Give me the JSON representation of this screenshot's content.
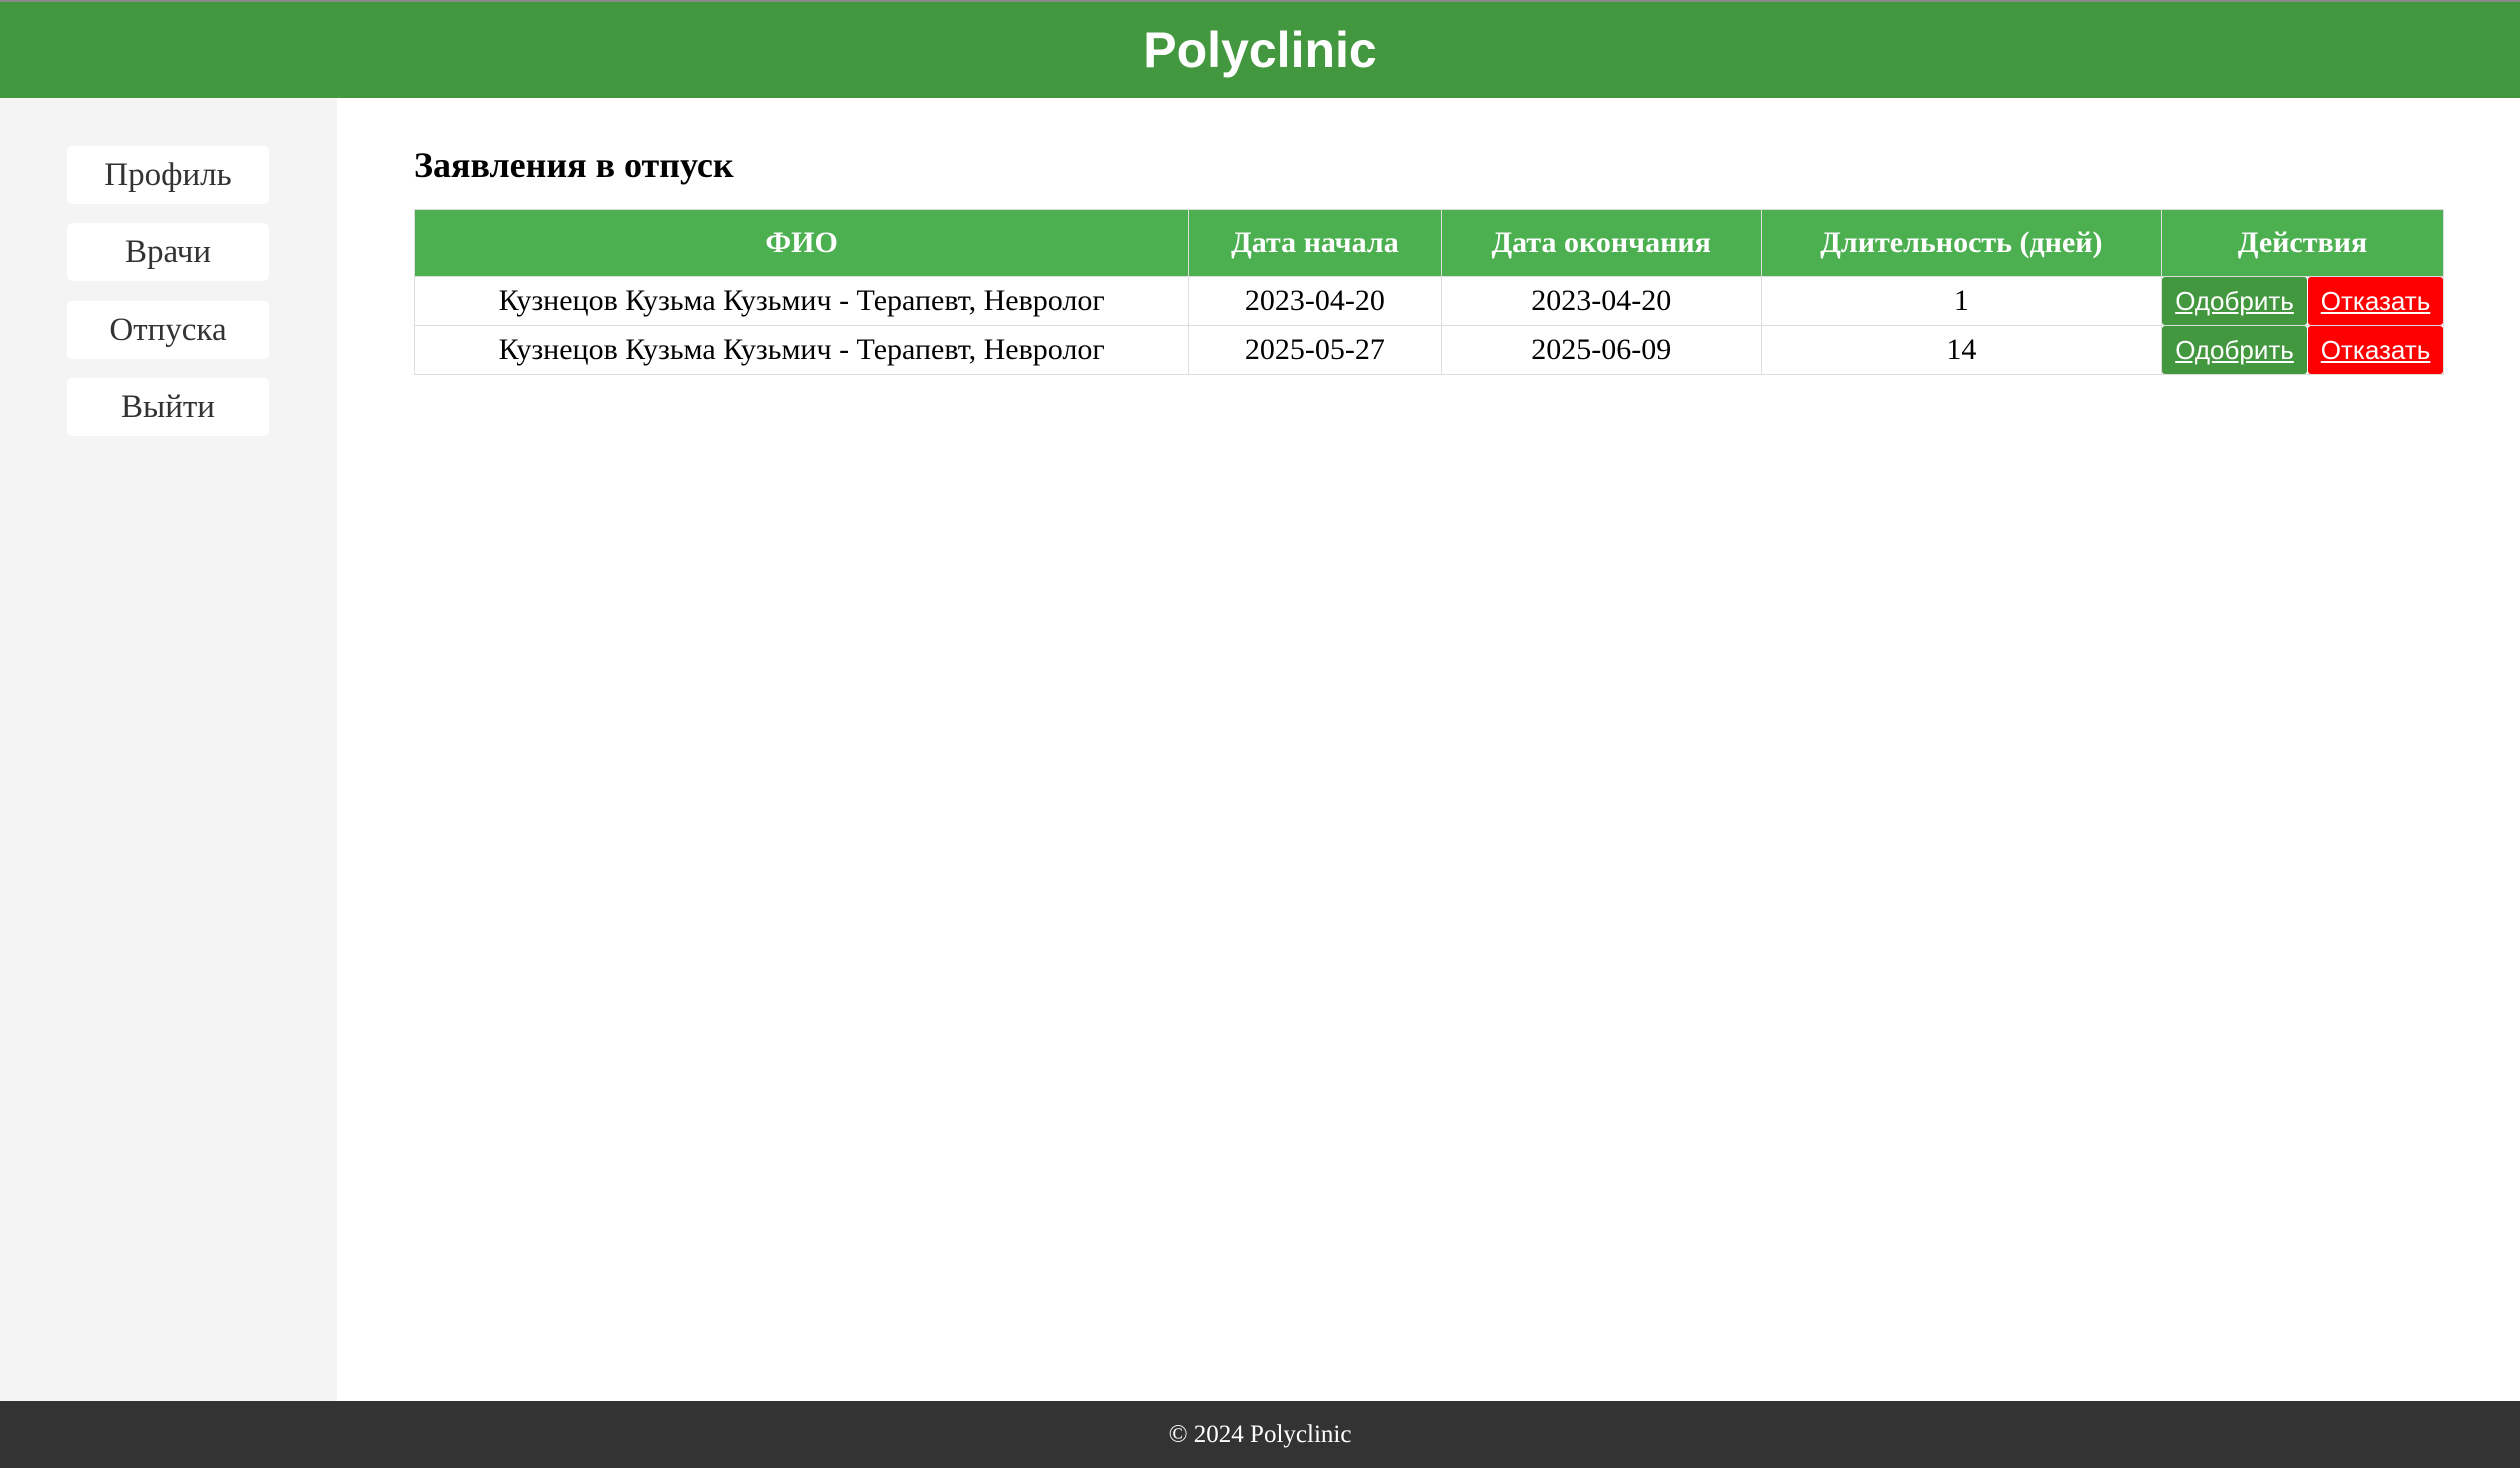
{
  "header": {
    "title": "Polyclinic"
  },
  "sidebar": {
    "items": [
      {
        "label": "Профиль"
      },
      {
        "label": "Врачи"
      },
      {
        "label": "Отпуска"
      },
      {
        "label": "Выйти"
      }
    ]
  },
  "main": {
    "title": "Заявления в отпуск",
    "table": {
      "columns": [
        "ФИО",
        "Дата начала",
        "Дата окончания",
        "Длительность (дней)",
        "Действия"
      ],
      "rows": [
        {
          "name": "Кузнецов Кузьма Кузьмич - Терапевт, Невролог",
          "start": "2023-04-20",
          "end": "2023-04-20",
          "days": "1"
        },
        {
          "name": "Кузнецов Кузьма Кузьмич - Терапевт, Невролог",
          "start": "2025-05-27",
          "end": "2025-06-09",
          "days": "14"
        }
      ],
      "approve_label": "Одобрить",
      "reject_label": "Отказать"
    }
  },
  "footer": {
    "text": "© 2024 Polyclinic"
  },
  "colors": {
    "header": "#43983f",
    "table_header": "#4caf50",
    "approve": "#43983f",
    "reject": "#ff0000",
    "footer": "#333333"
  }
}
